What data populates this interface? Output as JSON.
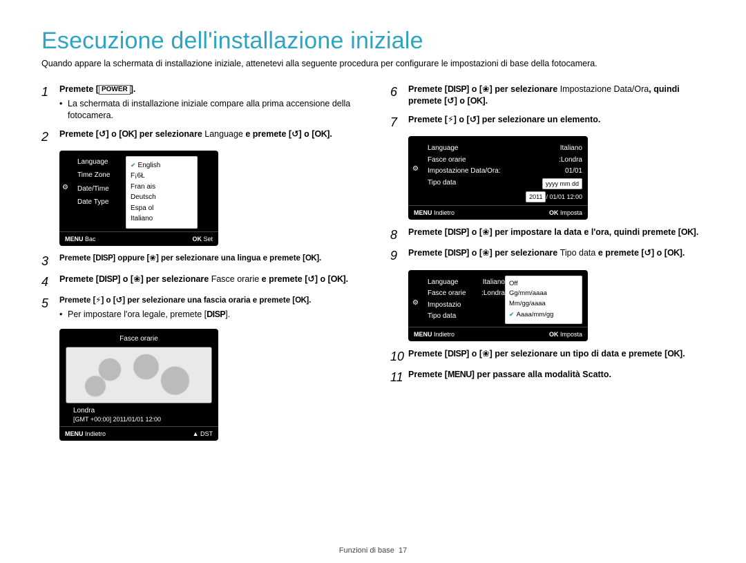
{
  "title": "Esecuzione dell'installazione iniziale",
  "intro": "Quando appare la schermata di installazione iniziale, attenetevi alla seguente procedura per configurare le impostazioni di base della fotocamera.",
  "icons": {
    "power": "POWER",
    "ok": "OK",
    "disp": "DISP",
    "menu": "MENU",
    "timer": "↺",
    "flash": "⚡",
    "macro": "❀",
    "gear": "⚙",
    "up": "▲",
    "check": "✔"
  },
  "steps": {
    "s1a": "Premete [",
    "s1b": "].",
    "s1sub": "La schermata di installazione iniziale compare alla prima accensione della fotocamera.",
    "s2a": "Premete [",
    "s2b": "] o [",
    "s2c": "] per selezionare ",
    "s2lang": "Language",
    "s2d": " e premete [",
    "s2e": "] o [",
    "s2f": "].",
    "s3a": "Premete [",
    "s3b": "] oppure [",
    "s3c": "] per selezionare una lingua e premete [",
    "s3d": "].",
    "s4a": "Premete [",
    "s4b": "] o [",
    "s4c": "] per selezionare ",
    "s4t": "Fasce orarie",
    "s4d": " e premete [",
    "s4e": "] o [",
    "s4f": "].",
    "s5a": "Premete [",
    "s5b": "] o [",
    "s5c": "] per selezionare una fascia oraria e premete [",
    "s5d": "].",
    "s5sub": "Per impostare l'ora legale, premete [",
    "s5sub2": "].",
    "s6a": "Premete [",
    "s6b": "] o [",
    "s6c": "] per selezionare ",
    "s6t": "Impostazione Data/Ora",
    "s6d": ", quindi premete [",
    "s6e": "] o [",
    "s6f": "].",
    "s7a": "Premete [",
    "s7b": "] o [",
    "s7c": "] per selezionare un elemento.",
    "s8a": "Premete [",
    "s8b": "] o [",
    "s8c": "] per impostare la data e l'ora, quindi premete [",
    "s8d": "].",
    "s9a": "Premete [",
    "s9b": "] o [",
    "s9c": "] per selezionare ",
    "s9t": "Tipo data",
    "s9d": " e premete [",
    "s9e": "] o [",
    "s9f": "].",
    "s10a": "Premete [",
    "s10b": "] o [",
    "s10c": "] per selezionare un tipo di data e premete [",
    "s10d": "].",
    "s11a": "Premete [",
    "s11b": "] per passare alla modalità Scatto."
  },
  "screen1": {
    "left": [
      "Language",
      "Time Zone",
      "Date/Time",
      "Date Type"
    ],
    "right": [
      "English",
      "F¡6Ł",
      "Fran ais",
      "Deutsch",
      "Espa ol",
      "Italiano"
    ],
    "back": "Bac",
    "set": "Set"
  },
  "screen2": {
    "title": "Fasce orarie",
    "city": "Londra",
    "tz": "[GMT +00:00] 2011/01/01 12:00",
    "back": "Indietro",
    "dst": "DST"
  },
  "screen3": {
    "rows": [
      [
        "Language",
        "Italiano"
      ],
      [
        "Fasce orarie",
        ":Londra"
      ],
      [
        "Impostazione Data/Ora:",
        "01/01"
      ],
      [
        "Tipo data",
        ""
      ]
    ],
    "datebox": "yyyy mm dd",
    "year": "2011",
    "rest": "/ 01/01  12:00",
    "back": "Indietro",
    "set": "Imposta"
  },
  "screen4": {
    "rows": [
      [
        "Language",
        "Italiano"
      ],
      [
        "Fasce orarie",
        ":Londra"
      ],
      [
        "Impostazio",
        ""
      ],
      [
        "Tipo data",
        ""
      ]
    ],
    "popup": [
      "Off",
      "Gg/mm/aaaa",
      "Mm/gg/aaaa",
      "Aaaa/mm/gg"
    ],
    "back": "Indietro",
    "set": "Imposta"
  },
  "footer": {
    "section": "Funzioni di base",
    "page": "17"
  }
}
